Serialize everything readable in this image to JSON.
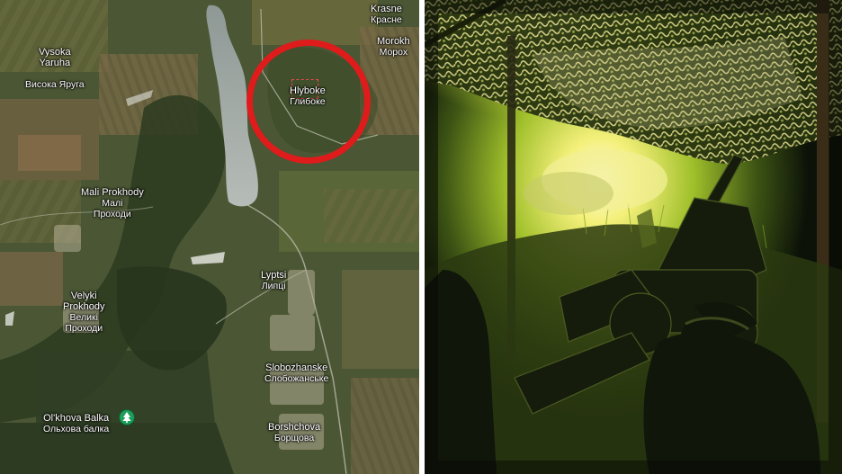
{
  "colors": {
    "highlight_ring": "#e01b1b",
    "village_boundary": "#e64a4a",
    "label_text": "#ffffff",
    "poi_pin": "#1e9e5a",
    "water": "#9aa3a4",
    "muzzle_flash": "#fff6b0"
  },
  "map": {
    "type": "satellite",
    "highlighted_place": "Hlyboke",
    "places": [
      {
        "id": "krasne",
        "latin": "Krasne",
        "cyrillic": "Красне"
      },
      {
        "id": "vysoka-yaruha",
        "latin": "Vysoka\nYaruha",
        "cyrillic": "Висока Яруга"
      },
      {
        "id": "morokhovets",
        "latin": "Morokh",
        "cyrillic": "Морох"
      },
      {
        "id": "hlyboke",
        "latin": "Hlyboke",
        "cyrillic": "Глибоке"
      },
      {
        "id": "mali-prokhody",
        "latin": "Mali Prokhody",
        "cyrillic": "Малі\nПроходи"
      },
      {
        "id": "lyptsi",
        "latin": "Lyptsi",
        "cyrillic": "Липці"
      },
      {
        "id": "velyki-prokhody",
        "latin": "Velyki\nProkhody",
        "cyrillic": "Великі\nПроходи"
      },
      {
        "id": "slobozhanske",
        "latin": "Slobozhanske",
        "cyrillic": "Слобожанське"
      },
      {
        "id": "olkhova-balka",
        "latin": "Ol'khova Balka",
        "cyrillic": "Ольхова балка",
        "icon": "tree-icon"
      },
      {
        "id": "borshchova",
        "latin": "Borshchova",
        "cyrillic": "Борщова"
      }
    ]
  },
  "photo": {
    "subject": "howitzer firing under camouflage netting",
    "icon": "artillery-photo"
  }
}
